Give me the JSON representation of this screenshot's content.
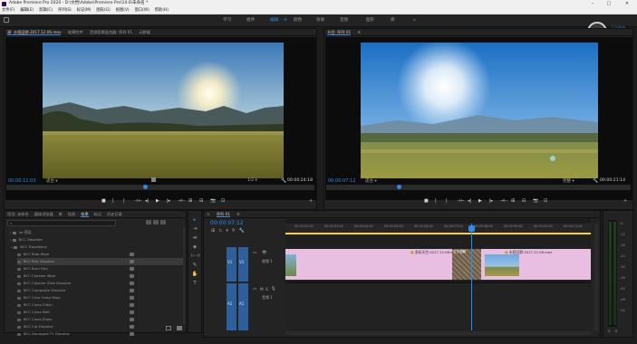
{
  "titlebar": {
    "title": "Adobe Premiere Pro 2020 - D:\\文档\\Adobe\\Premiere Pro\\14.0\\未命名 *",
    "min": "–",
    "max": "□",
    "close": "✕"
  },
  "menu": [
    "文件(F)",
    "编辑(E)",
    "剪辑(C)",
    "序列(S)",
    "标记(M)",
    "图形(G)",
    "视图(V)",
    "窗口(W)",
    "帮助(H)"
  ],
  "workspaces": [
    "学习",
    "组件",
    "编辑",
    "颜色",
    "效果",
    "音频",
    "图形",
    "库"
  ],
  "workspace_menu": "≡",
  "perf": {
    "percent": "46",
    "suffix": "%",
    "up": "0.2k/s",
    "down": "0k/s"
  },
  "source_monitor": {
    "tabs": [
      "源: 水稻田野.2017.12.06.mov",
      "效果控件",
      "音频剪辑混合器: 序列 01",
      "元数据"
    ],
    "timecode": "00:00:11:03",
    "fit": "适合",
    "duration": "00:00:24:18",
    "zoom": "1/2"
  },
  "program_monitor": {
    "tabs": [
      "节目: 序列 01"
    ],
    "timecode": "00:00:07:12",
    "fit": "适合",
    "quality": "完整",
    "duration": "00:00:21:14"
  },
  "transport": [
    "■",
    "|",
    "|",
    "⊣←",
    "◂|",
    "▶",
    "|▸",
    "→⊢",
    "⊞",
    "⊟",
    "📷",
    "⊡"
  ],
  "project_panel": {
    "tabs": [
      "项目: 未命名",
      "媒体浏览器",
      "库",
      "信息",
      "效果",
      "标记",
      "历史记录"
    ],
    "search_placeholder": "",
    "folders": [
      "lut 预设",
      "BCC Obsolete",
      "BCC Transitions"
    ],
    "effects": [
      "BCC Blob Wipe",
      "BCC Blur Dissolve",
      "BCC Burn Film",
      "BCC Checker Wipe",
      "BCC Colorize Glow Dissolve",
      "BCC Composite Dissolve",
      "BCC Criss Cross Wipe",
      "BCC Cross Glitch",
      "BCC Cross Melt",
      "BCC Cross Zoom",
      "BCC Cut Dissolve",
      "BCC Damaged TV Dissolve"
    ]
  },
  "tools": [
    "▸",
    "⇥",
    "⇹",
    "◈",
    "⊢⊣",
    "✎",
    "✋",
    "T"
  ],
  "timeline": {
    "tab": "序列 01",
    "timecode": "00:00:07:12",
    "ticks": [
      "00:00:02:00",
      "00:00:03:00",
      "00:00:04:00",
      "00:00:05:00",
      "00:00:06:00",
      "00:00:07:00",
      "00:00:08:00",
      "00:00:09:00",
      "00:00:10:00",
      "00:00:11:00"
    ],
    "tracks": [
      {
        "label": "V1",
        "src": "V1",
        "name": "视频 1"
      },
      {
        "label": "A1",
        "src": "A1",
        "name": "音频 1"
      }
    ],
    "clips": [
      {
        "name": "多彩天空.2017.12.06.mov"
      },
      {
        "name": "水稻田野.2017.12.06.mov"
      }
    ],
    "transition": "交叉溶解"
  },
  "meter": {
    "labels": [
      "-6",
      "-12",
      "-18",
      "-24",
      "-30",
      "-36",
      "-42",
      "-48",
      "-54"
    ],
    "solo": "S",
    "s2": "S"
  }
}
